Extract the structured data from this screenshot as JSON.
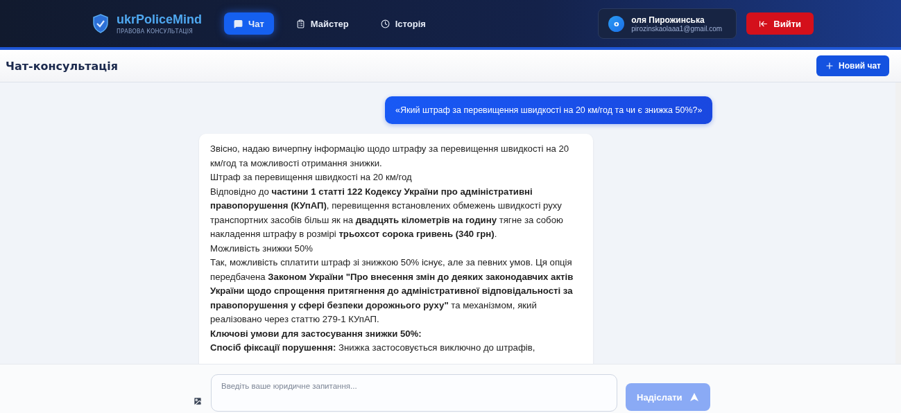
{
  "brand": {
    "name": "ukrPoliceMind",
    "subtitle": "ПРАВОВА КОНСУЛЬТАЦІЯ"
  },
  "nav": [
    {
      "label": "Чат",
      "kind": "chat",
      "selected": true
    },
    {
      "label": "Майстер",
      "kind": "wizard",
      "selected": false
    },
    {
      "label": "Історія",
      "kind": "history",
      "selected": false
    }
  ],
  "user": {
    "initial": "о",
    "name": "оля Пирожинська",
    "email": "pirozinskaolaaa1@gmail.com"
  },
  "logout_button": "Вийти",
  "page_title": "Чат-консультація",
  "new_chat_button": "Новий чат",
  "messages": [
    {
      "kind": "user",
      "paragraphs": [
        "«Який штраф за перевищення швидкості на 20 км/год та чи є знижка 50%?»"
      ]
    },
    {
      "kind": "assistant",
      "paragraphs": [
        "Звісно, надаю вичерпну інформацію щодо штрафу за перевищення швидкості на 20 км/год та можливості отримання знижки.",
        "Штраф за перевищення швидкості на 20 км/год",
        "Відповідно до **частини 1 статті 122 Кодексу України про адміністративні правопорушення (КУпАП)**, перевищення встановлених обмежень швидкості руху транспортних засобів більш як на **двадцять кілометрів на годину** тягне за собою накладення штрафу в розмірі **трьохсот сорока гривень (340 грн)**.",
        "Можливість знижки 50%",
        "Так, можливість сплатити штраф зі знижкою 50% існує, але за певних умов. Ця опція передбачена **Законом України \"Про внесення змін до деяких законодавчих актів України щодо спрощення притягнення до адміністративної відповідальності за правопорушення у сфері безпеки дорожнього руху\"** та механізмом, який реалізовано через статтю 279-1 КУпАП.",
        "**Ключові умови для застосування знижки 50%:**",
        "**Спосіб фіксації порушення:** Знижка застосовується виключно до штрафів,"
      ]
    }
  ],
  "composer": {
    "placeholder": "Введіть ваше юридичне запитання...",
    "send_button": "Надіслати",
    "send_disabled": true
  }
}
